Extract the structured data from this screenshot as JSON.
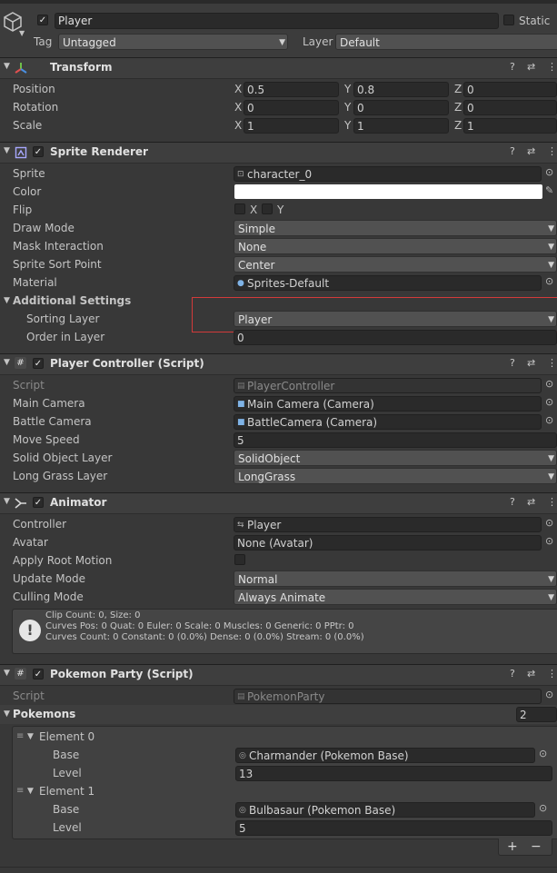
{
  "gameobject": {
    "name": "Player",
    "static_label": "Static",
    "tag_label": "Tag",
    "tag_value": "Untagged",
    "layer_label": "Layer",
    "layer_value": "Default"
  },
  "transform": {
    "title": "Transform",
    "rows": [
      {
        "label": "Position",
        "x": "0.5",
        "y": "0.8",
        "z": "0"
      },
      {
        "label": "Rotation",
        "x": "0",
        "y": "0",
        "z": "0"
      },
      {
        "label": "Scale",
        "x": "1",
        "y": "1",
        "z": "1"
      }
    ],
    "axis": {
      "x": "X",
      "y": "Y",
      "z": "Z"
    }
  },
  "sprite_renderer": {
    "title": "Sprite Renderer",
    "sprite_label": "Sprite",
    "sprite_value": "character_0",
    "color_label": "Color",
    "color_value": "#ffffff",
    "flip_label": "Flip",
    "flip_x": "X",
    "flip_y": "Y",
    "draw_mode_label": "Draw Mode",
    "draw_mode_value": "Simple",
    "mask_label": "Mask Interaction",
    "mask_value": "None",
    "sort_point_label": "Sprite Sort Point",
    "sort_point_value": "Center",
    "material_label": "Material",
    "material_value": "Sprites-Default",
    "additional_label": "Additional Settings",
    "sorting_layer_label": "Sorting Layer",
    "sorting_layer_value": "Player",
    "order_label": "Order in Layer",
    "order_value": "0",
    "highlight_color": "#d23a3a"
  },
  "player_controller": {
    "title": "Player Controller (Script)",
    "script_label": "Script",
    "script_value": "PlayerController",
    "main_camera_label": "Main Camera",
    "main_camera_value": "Main Camera (Camera)",
    "battle_camera_label": "Battle Camera",
    "battle_camera_value": "BattleCamera (Camera)",
    "move_speed_label": "Move Speed",
    "move_speed_value": "5",
    "solid_label": "Solid Object Layer",
    "solid_value": "SolidObject",
    "grass_label": "Long Grass Layer",
    "grass_value": "LongGrass"
  },
  "animator": {
    "title": "Animator",
    "controller_label": "Controller",
    "controller_value": "Player",
    "avatar_label": "Avatar",
    "avatar_value": "None (Avatar)",
    "root_motion_label": "Apply Root Motion",
    "update_label": "Update Mode",
    "update_value": "Normal",
    "culling_label": "Culling Mode",
    "culling_value": "Always Animate",
    "info_line1": "Clip Count: 0, Size: 0",
    "info_line2": "Curves Pos: 0 Quat: 0 Euler: 0 Scale: 0 Muscles: 0 Generic: 0 PPtr: 0",
    "info_line3": "Curves Count: 0 Constant: 0 (0.0%) Dense: 0 (0.0%) Stream: 0 (0.0%)"
  },
  "pokemon_party": {
    "title": "Pokemon Party (Script)",
    "script_label": "Script",
    "script_value": "PokemonParty",
    "list_label": "Pokemons",
    "list_count": "2",
    "elements": [
      {
        "label": "Element 0",
        "base_label": "Base",
        "base_value": "Charmander (Pokemon Base)",
        "level_label": "Level",
        "level_value": "13"
      },
      {
        "label": "Element 1",
        "base_label": "Base",
        "base_value": "Bulbasaur (Pokemon Base)",
        "level_label": "Level",
        "level_value": "5"
      }
    ],
    "add_label": "+",
    "remove_label": "−"
  }
}
